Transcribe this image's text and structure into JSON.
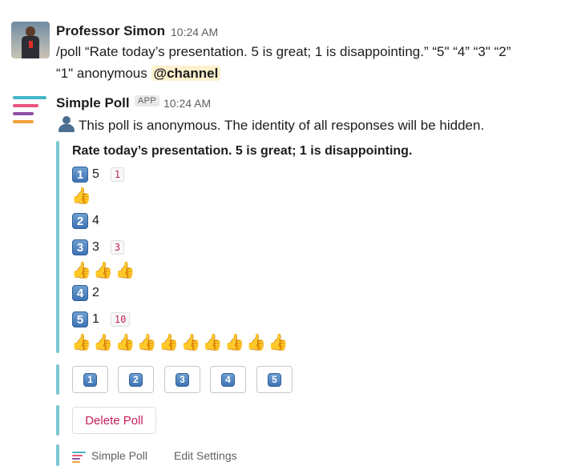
{
  "message1": {
    "sender": "Professor Simon",
    "time": "10:24 AM",
    "line1": "/poll “Rate today’s presentation. 5 is great; 1 is disappointing.” “5\" “4” “3\" “2”",
    "line2_prefix": "“1\" anonymous ",
    "mention": "@channel"
  },
  "message2": {
    "sender": "Simple Poll",
    "app_badge": "APP",
    "time": "10:24 AM",
    "anon_notice": "This poll is anonymous. The identity of all responses will be hidden.",
    "question": "Rate today’s presentation. 5 is great; 1 is disappointing.",
    "options": [
      {
        "key": "1",
        "label": "5",
        "count": "1",
        "votes": 1
      },
      {
        "key": "2",
        "label": "4",
        "count": "",
        "votes": 0
      },
      {
        "key": "3",
        "label": "3",
        "count": "3",
        "votes": 3
      },
      {
        "key": "4",
        "label": "2",
        "count": "",
        "votes": 0
      },
      {
        "key": "5",
        "label": "1",
        "count": "10",
        "votes": 10
      }
    ],
    "vote_buttons": [
      "1",
      "2",
      "3",
      "4",
      "5"
    ],
    "delete_label": "Delete Poll",
    "footer_app": "Simple Poll",
    "footer_settings": "Edit Settings"
  },
  "icons": {
    "thumb": "thumbs-up-icon",
    "keycap": "number-keycap-icon",
    "anon": "bust-silhouette-icon"
  },
  "colors": {
    "quote_bar": "#7cc7d2",
    "count_text": "#c41e5c",
    "mention_bg": "#fdf2cf",
    "logo_teal": "#43b5c7",
    "logo_pink": "#e8567c",
    "logo_purple": "#8a4fa3",
    "logo_orange": "#f2a23a"
  }
}
